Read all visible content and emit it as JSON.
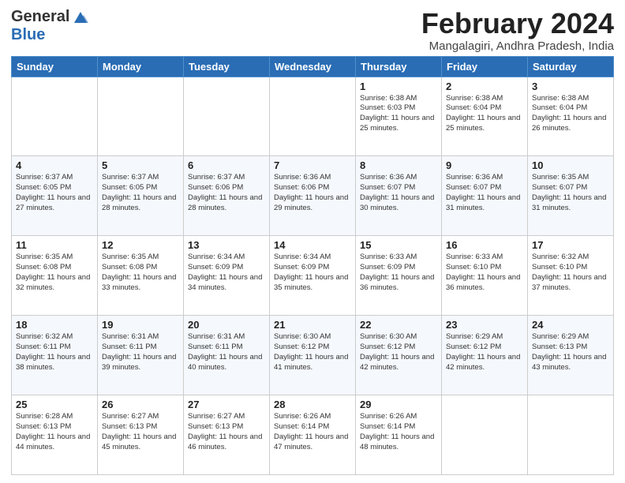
{
  "logo": {
    "general": "General",
    "blue": "Blue"
  },
  "header": {
    "month": "February 2024",
    "location": "Mangalagiri, Andhra Pradesh, India"
  },
  "weekdays": [
    "Sunday",
    "Monday",
    "Tuesday",
    "Wednesday",
    "Thursday",
    "Friday",
    "Saturday"
  ],
  "weeks": [
    [
      {
        "date": "",
        "info": ""
      },
      {
        "date": "",
        "info": ""
      },
      {
        "date": "",
        "info": ""
      },
      {
        "date": "",
        "info": ""
      },
      {
        "date": "1",
        "info": "Sunrise: 6:38 AM\nSunset: 6:03 PM\nDaylight: 11 hours\nand 25 minutes."
      },
      {
        "date": "2",
        "info": "Sunrise: 6:38 AM\nSunset: 6:04 PM\nDaylight: 11 hours\nand 25 minutes."
      },
      {
        "date": "3",
        "info": "Sunrise: 6:38 AM\nSunset: 6:04 PM\nDaylight: 11 hours\nand 26 minutes."
      }
    ],
    [
      {
        "date": "4",
        "info": "Sunrise: 6:37 AM\nSunset: 6:05 PM\nDaylight: 11 hours\nand 27 minutes."
      },
      {
        "date": "5",
        "info": "Sunrise: 6:37 AM\nSunset: 6:05 PM\nDaylight: 11 hours\nand 28 minutes."
      },
      {
        "date": "6",
        "info": "Sunrise: 6:37 AM\nSunset: 6:06 PM\nDaylight: 11 hours\nand 28 minutes."
      },
      {
        "date": "7",
        "info": "Sunrise: 6:36 AM\nSunset: 6:06 PM\nDaylight: 11 hours\nand 29 minutes."
      },
      {
        "date": "8",
        "info": "Sunrise: 6:36 AM\nSunset: 6:07 PM\nDaylight: 11 hours\nand 30 minutes."
      },
      {
        "date": "9",
        "info": "Sunrise: 6:36 AM\nSunset: 6:07 PM\nDaylight: 11 hours\nand 31 minutes."
      },
      {
        "date": "10",
        "info": "Sunrise: 6:35 AM\nSunset: 6:07 PM\nDaylight: 11 hours\nand 31 minutes."
      }
    ],
    [
      {
        "date": "11",
        "info": "Sunrise: 6:35 AM\nSunset: 6:08 PM\nDaylight: 11 hours\nand 32 minutes."
      },
      {
        "date": "12",
        "info": "Sunrise: 6:35 AM\nSunset: 6:08 PM\nDaylight: 11 hours\nand 33 minutes."
      },
      {
        "date": "13",
        "info": "Sunrise: 6:34 AM\nSunset: 6:09 PM\nDaylight: 11 hours\nand 34 minutes."
      },
      {
        "date": "14",
        "info": "Sunrise: 6:34 AM\nSunset: 6:09 PM\nDaylight: 11 hours\nand 35 minutes."
      },
      {
        "date": "15",
        "info": "Sunrise: 6:33 AM\nSunset: 6:09 PM\nDaylight: 11 hours\nand 36 minutes."
      },
      {
        "date": "16",
        "info": "Sunrise: 6:33 AM\nSunset: 6:10 PM\nDaylight: 11 hours\nand 36 minutes."
      },
      {
        "date": "17",
        "info": "Sunrise: 6:32 AM\nSunset: 6:10 PM\nDaylight: 11 hours\nand 37 minutes."
      }
    ],
    [
      {
        "date": "18",
        "info": "Sunrise: 6:32 AM\nSunset: 6:11 PM\nDaylight: 11 hours\nand 38 minutes."
      },
      {
        "date": "19",
        "info": "Sunrise: 6:31 AM\nSunset: 6:11 PM\nDaylight: 11 hours\nand 39 minutes."
      },
      {
        "date": "20",
        "info": "Sunrise: 6:31 AM\nSunset: 6:11 PM\nDaylight: 11 hours\nand 40 minutes."
      },
      {
        "date": "21",
        "info": "Sunrise: 6:30 AM\nSunset: 6:12 PM\nDaylight: 11 hours\nand 41 minutes."
      },
      {
        "date": "22",
        "info": "Sunrise: 6:30 AM\nSunset: 6:12 PM\nDaylight: 11 hours\nand 42 minutes."
      },
      {
        "date": "23",
        "info": "Sunrise: 6:29 AM\nSunset: 6:12 PM\nDaylight: 11 hours\nand 42 minutes."
      },
      {
        "date": "24",
        "info": "Sunrise: 6:29 AM\nSunset: 6:13 PM\nDaylight: 11 hours\nand 43 minutes."
      }
    ],
    [
      {
        "date": "25",
        "info": "Sunrise: 6:28 AM\nSunset: 6:13 PM\nDaylight: 11 hours\nand 44 minutes."
      },
      {
        "date": "26",
        "info": "Sunrise: 6:27 AM\nSunset: 6:13 PM\nDaylight: 11 hours\nand 45 minutes."
      },
      {
        "date": "27",
        "info": "Sunrise: 6:27 AM\nSunset: 6:13 PM\nDaylight: 11 hours\nand 46 minutes."
      },
      {
        "date": "28",
        "info": "Sunrise: 6:26 AM\nSunset: 6:14 PM\nDaylight: 11 hours\nand 47 minutes."
      },
      {
        "date": "29",
        "info": "Sunrise: 6:26 AM\nSunset: 6:14 PM\nDaylight: 11 hours\nand 48 minutes."
      },
      {
        "date": "",
        "info": ""
      },
      {
        "date": "",
        "info": ""
      }
    ]
  ]
}
